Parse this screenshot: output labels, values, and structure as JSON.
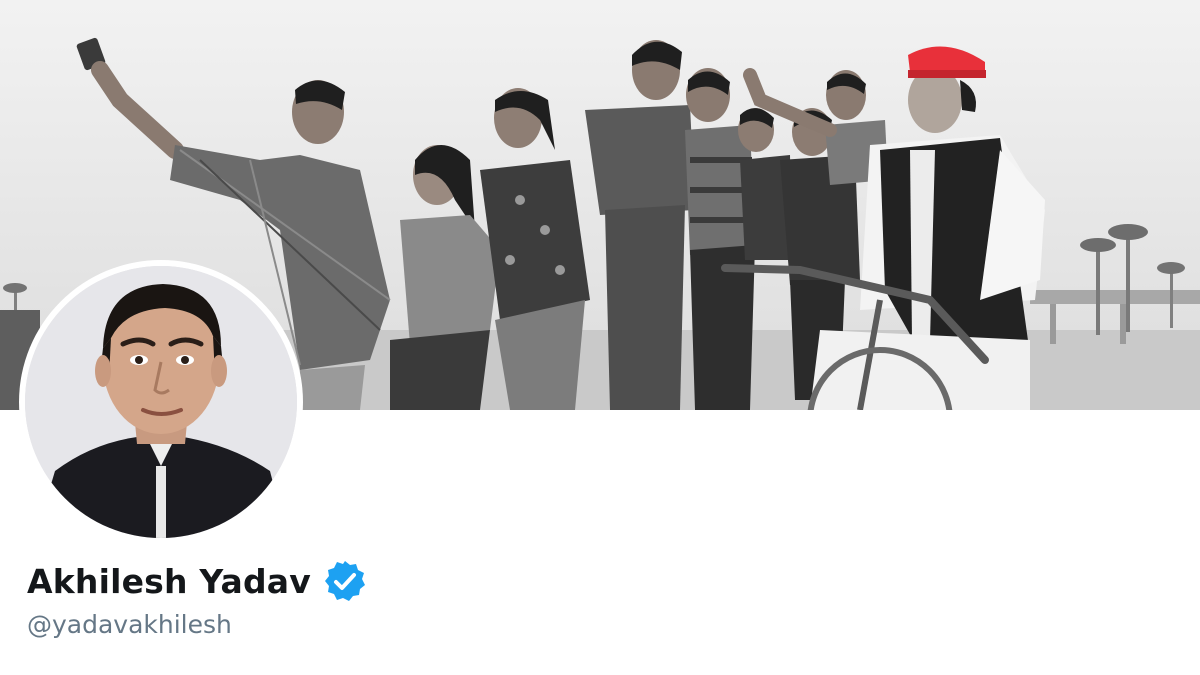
{
  "profile": {
    "display_name": "Akhilesh Yadav",
    "handle": "@yadavakhilesh",
    "verified": true
  },
  "icons": {
    "verified": "verified-badge-icon"
  },
  "colors": {
    "name": "#14171a",
    "handle": "#657786",
    "verified_badge": "#1da1f2",
    "cap_accent": "#e8303a"
  }
}
